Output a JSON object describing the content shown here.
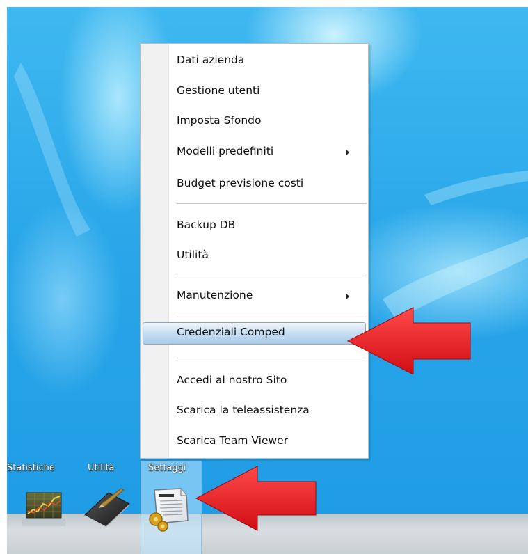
{
  "context_menu": {
    "items": [
      {
        "label": "Dati azienda"
      },
      {
        "label": "Gestione utenti"
      },
      {
        "label": "Imposta Sfondo"
      },
      {
        "label": "Modelli predefiniti",
        "submenu": true
      },
      {
        "label": "Budget previsione costi"
      },
      {
        "label": "Backup DB"
      },
      {
        "label": "Utilità"
      },
      {
        "label": "Manutenzione",
        "submenu": true
      },
      {
        "label": "Credenziali Comped",
        "highlighted": true
      },
      {
        "label": "Accedi al nostro Sito"
      },
      {
        "label": "Scarica la teleassistenza"
      },
      {
        "label": "Scarica Team Viewer"
      }
    ]
  },
  "taskbar": {
    "buttons": [
      {
        "label": "Statistiche",
        "icon": "statistics-chart-icon"
      },
      {
        "label": "Utilità",
        "icon": "notebook-pen-icon"
      },
      {
        "label": "Settaggi",
        "icon": "document-gears-icon",
        "selected": true
      }
    ]
  },
  "colors": {
    "desktop_blue": "#29a6e9",
    "menu_highlight": "#a8cbea",
    "arrow_red": "#e8141b"
  }
}
